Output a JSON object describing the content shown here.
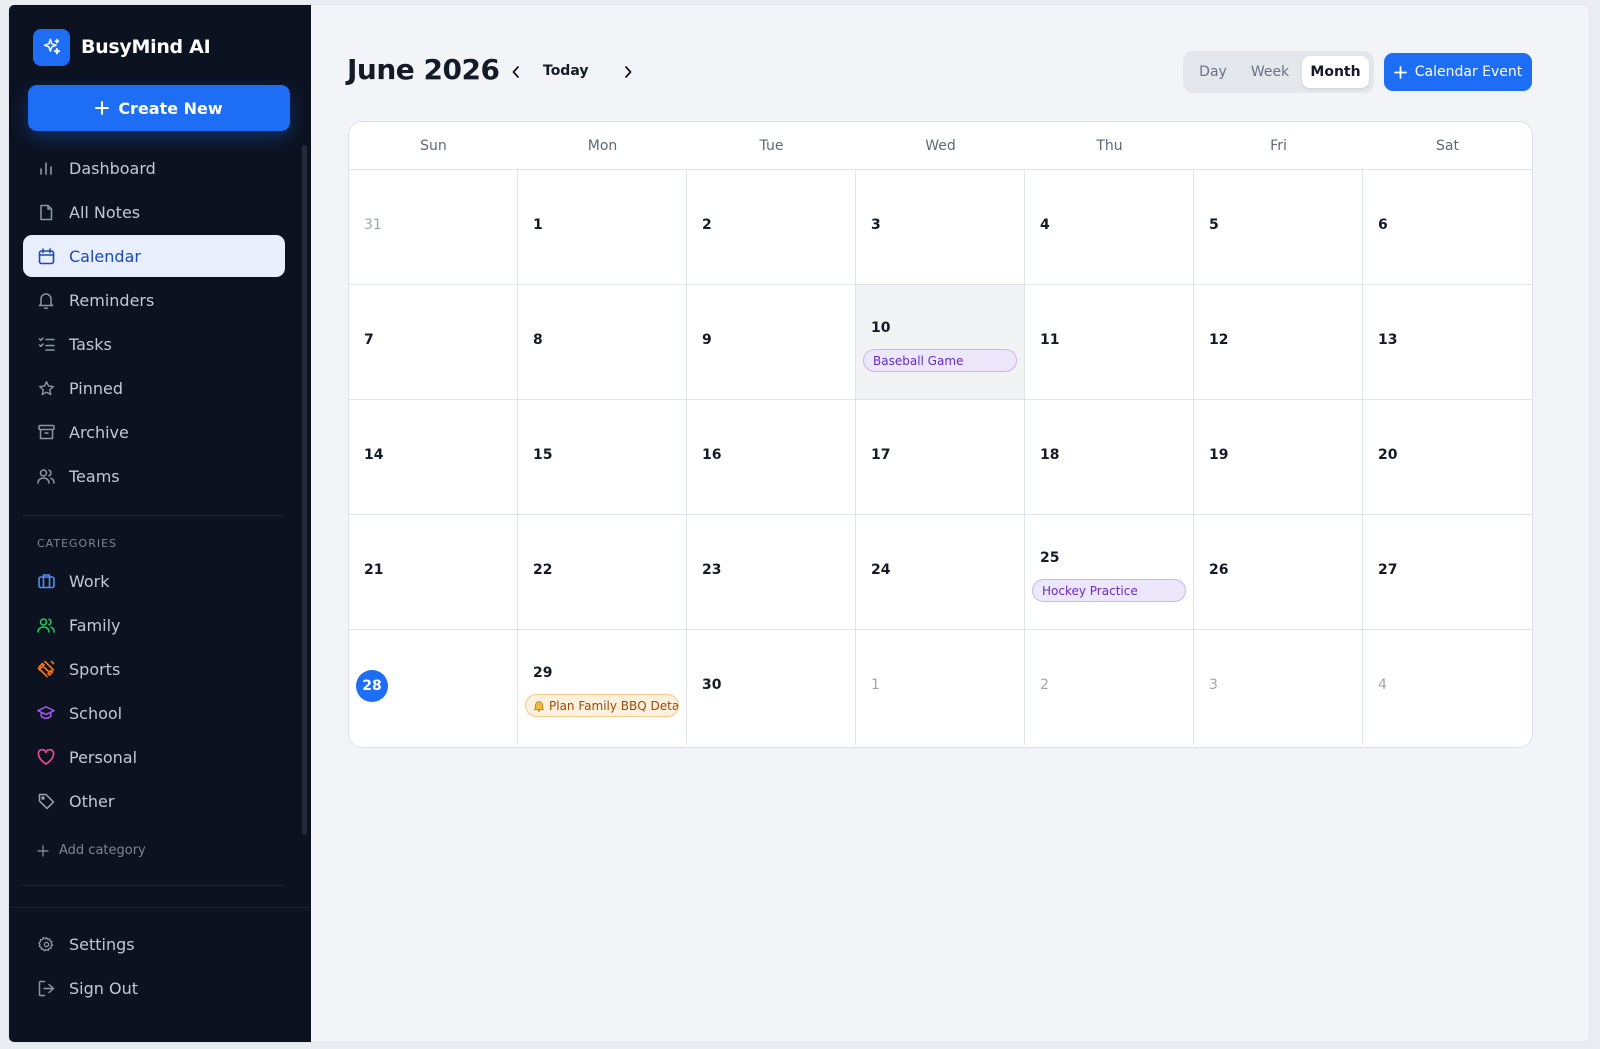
{
  "app": {
    "name": "BusyMind AI",
    "create_label": "Create New"
  },
  "nav": [
    {
      "label": "Dashboard",
      "icon": "bar-chart-icon",
      "active": false
    },
    {
      "label": "All Notes",
      "icon": "note-icon",
      "active": false
    },
    {
      "label": "Calendar",
      "icon": "calendar-icon",
      "active": true
    },
    {
      "label": "Reminders",
      "icon": "bell-icon",
      "active": false
    },
    {
      "label": "Tasks",
      "icon": "checklist-icon",
      "active": false
    },
    {
      "label": "Pinned",
      "icon": "star-icon",
      "active": false
    },
    {
      "label": "Archive",
      "icon": "archive-icon",
      "active": false
    },
    {
      "label": "Teams",
      "icon": "users-icon",
      "active": false
    }
  ],
  "categories": {
    "header": "CATEGORIES",
    "items": [
      {
        "label": "Work",
        "icon": "briefcase-icon",
        "color": "#4f8ef7"
      },
      {
        "label": "Family",
        "icon": "users-icon",
        "color": "#22c55e"
      },
      {
        "label": "Sports",
        "icon": "dumbbell-icon",
        "color": "#f97316"
      },
      {
        "label": "School",
        "icon": "graduation-cap-icon",
        "color": "#a855f7"
      },
      {
        "label": "Personal",
        "icon": "heart-icon",
        "color": "#ec4899"
      },
      {
        "label": "Other",
        "icon": "tag-icon",
        "color": "#9ca3af"
      }
    ],
    "add_label": "Add category"
  },
  "bottom_nav": [
    {
      "label": "Settings",
      "icon": "gear-icon"
    },
    {
      "label": "Sign Out",
      "icon": "sign-out-icon"
    }
  ],
  "header": {
    "month_title": "June 2026",
    "today_label": "Today",
    "views": [
      "Day",
      "Week",
      "Month"
    ],
    "active_view": "Month",
    "event_button": "Calendar Event"
  },
  "calendar": {
    "days_of_week": [
      "Sun",
      "Mon",
      "Tue",
      "Wed",
      "Thu",
      "Fri",
      "Sat"
    ],
    "weeks": [
      [
        {
          "d": "31",
          "muted": true
        },
        {
          "d": "1"
        },
        {
          "d": "2"
        },
        {
          "d": "3"
        },
        {
          "d": "4"
        },
        {
          "d": "5"
        },
        {
          "d": "6"
        }
      ],
      [
        {
          "d": "7"
        },
        {
          "d": "8"
        },
        {
          "d": "9"
        },
        {
          "d": "10",
          "highlight": true,
          "event": {
            "title": "Baseball Game",
            "style": "purple"
          }
        },
        {
          "d": "11"
        },
        {
          "d": "12"
        },
        {
          "d": "13"
        }
      ],
      [
        {
          "d": "14"
        },
        {
          "d": "15"
        },
        {
          "d": "16"
        },
        {
          "d": "17"
        },
        {
          "d": "18"
        },
        {
          "d": "19"
        },
        {
          "d": "20"
        }
      ],
      [
        {
          "d": "21"
        },
        {
          "d": "22"
        },
        {
          "d": "23"
        },
        {
          "d": "24"
        },
        {
          "d": "25",
          "event": {
            "title": "Hockey Practice",
            "style": "purple"
          }
        },
        {
          "d": "26"
        },
        {
          "d": "27"
        }
      ],
      [
        {
          "d": "28",
          "today": true
        },
        {
          "d": "29",
          "event": {
            "title": "Plan Family BBQ Deta...",
            "style": "orange",
            "bell": true
          }
        },
        {
          "d": "30"
        },
        {
          "d": "1",
          "muted": true
        },
        {
          "d": "2",
          "muted": true
        },
        {
          "d": "3",
          "muted": true
        },
        {
          "d": "4",
          "muted": true
        }
      ]
    ]
  }
}
